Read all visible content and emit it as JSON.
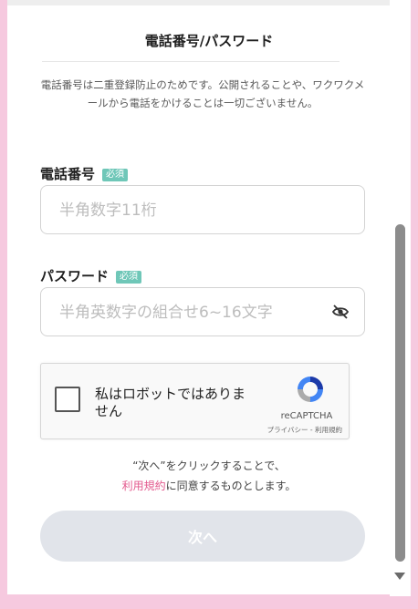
{
  "header": {
    "title": "電話番号/パスワード"
  },
  "description": "電話番号は二重登録防止のためです。公開されることや、ワクワクメールから電話をかけることは一切ございません。",
  "phone": {
    "label": "電話番号",
    "badge": "必須",
    "placeholder": "半角数字11桁",
    "value": ""
  },
  "password": {
    "label": "パスワード",
    "badge": "必須",
    "placeholder": "半角英数字の組合せ6~16文字",
    "value": "",
    "toggle_icon": "eye-slash-icon"
  },
  "recaptcha": {
    "label": "私はロボットではありません",
    "brand": "reCAPTCHA",
    "links": "プライバシー - 利用規約",
    "checked": false
  },
  "terms": {
    "line1": "“次へ”をクリックすることで、",
    "link": "利用規約",
    "line2_suffix": "に同意するものとします。"
  },
  "next_button": {
    "label": "次へ"
  },
  "colors": {
    "badge": "#6fc7b8",
    "link": "#e35a8e",
    "border": "#f6c9df",
    "button_disabled": "#e1e4ea"
  }
}
